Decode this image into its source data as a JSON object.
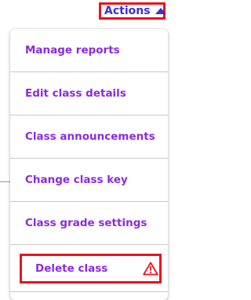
{
  "header": {
    "actions_label": "Actions",
    "caret_icon": "caret-up-icon"
  },
  "menu": {
    "items": [
      {
        "label": "Manage reports"
      },
      {
        "label": "Edit class details"
      },
      {
        "label": "Class announcements"
      },
      {
        "label": "Change class key"
      },
      {
        "label": "Class grade settings"
      }
    ],
    "delete": {
      "label": "Delete class",
      "icon": "warning-icon"
    }
  },
  "colors": {
    "accent": "#8c2ae0",
    "actions_text": "#3b2fd6",
    "highlight": "#e8141d"
  }
}
